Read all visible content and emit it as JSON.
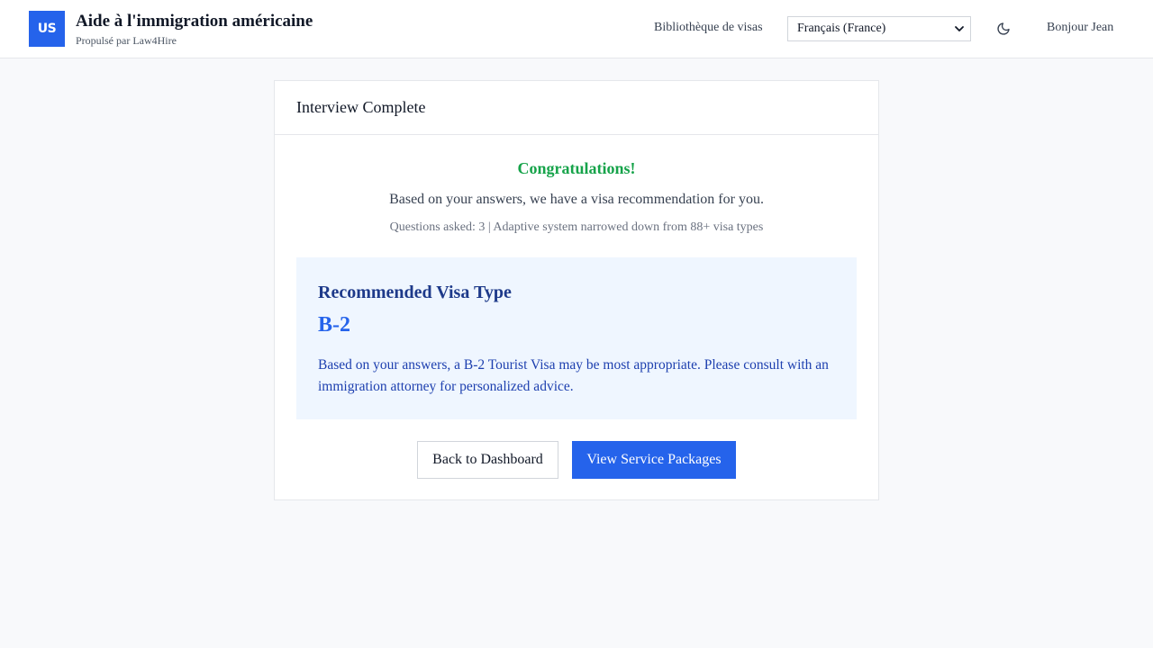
{
  "header": {
    "logo_text": "US",
    "app_title": "Aide à l'immigration américaine",
    "powered_by": "Propulsé par Law4Hire",
    "nav_visa_library": "Bibliothèque de visas",
    "language_selected": "Français (France)",
    "theme_icon": "moon-icon",
    "greeting": "Bonjour Jean"
  },
  "card": {
    "title": "Interview Complete",
    "congrats": "Congratulations!",
    "subtitle": "Based on your answers, we have a visa recommendation for you.",
    "meta": "Questions asked: 3 | Adaptive system narrowed down from 88+ visa types",
    "recommendation": {
      "heading": "Recommended Visa Type",
      "code": "B-2",
      "description": "Based on your answers, a B-2 Tourist Visa may be most appropriate. Please consult with an immigration attorney for personalized advice."
    },
    "buttons": {
      "back": "Back to Dashboard",
      "packages": "View Service Packages"
    }
  },
  "colors": {
    "accent": "#2563eb",
    "success": "#16a34a",
    "recommendation_bg": "#eff6ff",
    "page_bg": "#f8f9fb"
  }
}
